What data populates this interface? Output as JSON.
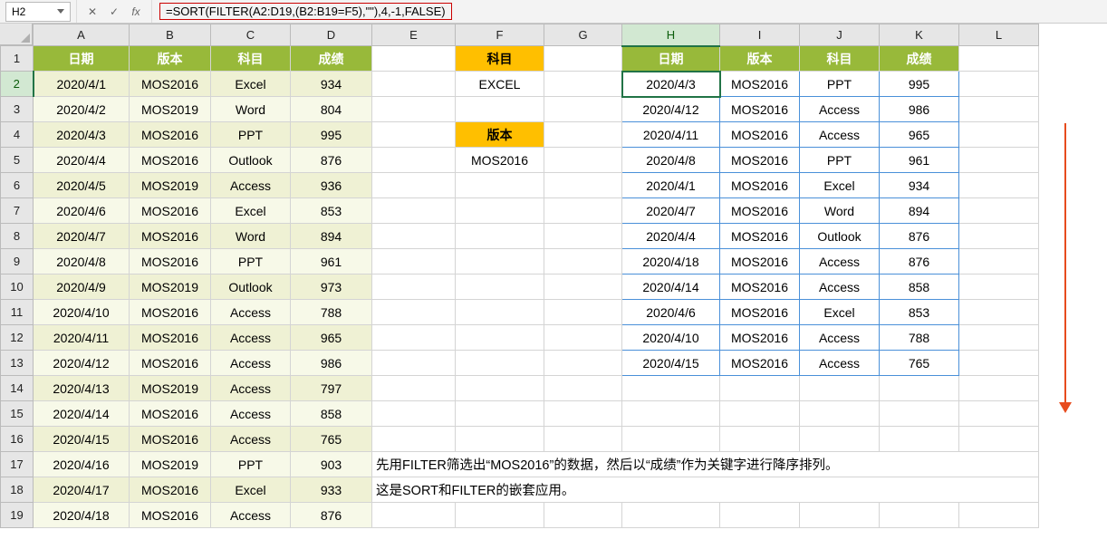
{
  "nameBox": "H2",
  "formula": "=SORT(FILTER(A2:D19,(B2:B19=F5),\"\"),4,-1,FALSE)",
  "fbIcons": {
    "cancel": "✕",
    "confirm": "✓",
    "fx": "fx"
  },
  "columns": [
    "A",
    "B",
    "C",
    "D",
    "E",
    "F",
    "G",
    "H",
    "I",
    "J",
    "K",
    "L"
  ],
  "leftHeader": [
    "日期",
    "版本",
    "科目",
    "成绩"
  ],
  "leftData": [
    [
      "2020/4/1",
      "MOS2016",
      "Excel",
      "934"
    ],
    [
      "2020/4/2",
      "MOS2019",
      "Word",
      "804"
    ],
    [
      "2020/4/3",
      "MOS2016",
      "PPT",
      "995"
    ],
    [
      "2020/4/4",
      "MOS2016",
      "Outlook",
      "876"
    ],
    [
      "2020/4/5",
      "MOS2019",
      "Access",
      "936"
    ],
    [
      "2020/4/6",
      "MOS2016",
      "Excel",
      "853"
    ],
    [
      "2020/4/7",
      "MOS2016",
      "Word",
      "894"
    ],
    [
      "2020/4/8",
      "MOS2016",
      "PPT",
      "961"
    ],
    [
      "2020/4/9",
      "MOS2019",
      "Outlook",
      "973"
    ],
    [
      "2020/4/10",
      "MOS2016",
      "Access",
      "788"
    ],
    [
      "2020/4/11",
      "MOS2016",
      "Access",
      "965"
    ],
    [
      "2020/4/12",
      "MOS2016",
      "Access",
      "986"
    ],
    [
      "2020/4/13",
      "MOS2019",
      "Access",
      "797"
    ],
    [
      "2020/4/14",
      "MOS2016",
      "Access",
      "858"
    ],
    [
      "2020/4/15",
      "MOS2016",
      "Access",
      "765"
    ],
    [
      "2020/4/16",
      "MOS2019",
      "PPT",
      "903"
    ],
    [
      "2020/4/17",
      "MOS2016",
      "Excel",
      "933"
    ],
    [
      "2020/4/18",
      "MOS2016",
      "Access",
      "876"
    ]
  ],
  "filterLabels": {
    "subject": "科目",
    "subjectVal": "EXCEL",
    "version": "版本",
    "versionVal": "MOS2016"
  },
  "rightHeader": [
    "日期",
    "版本",
    "科目",
    "成绩"
  ],
  "rightData": [
    [
      "2020/4/3",
      "MOS2016",
      "PPT",
      "995"
    ],
    [
      "2020/4/12",
      "MOS2016",
      "Access",
      "986"
    ],
    [
      "2020/4/11",
      "MOS2016",
      "Access",
      "965"
    ],
    [
      "2020/4/8",
      "MOS2016",
      "PPT",
      "961"
    ],
    [
      "2020/4/1",
      "MOS2016",
      "Excel",
      "934"
    ],
    [
      "2020/4/7",
      "MOS2016",
      "Word",
      "894"
    ],
    [
      "2020/4/4",
      "MOS2016",
      "Outlook",
      "876"
    ],
    [
      "2020/4/18",
      "MOS2016",
      "Access",
      "876"
    ],
    [
      "2020/4/14",
      "MOS2016",
      "Access",
      "858"
    ],
    [
      "2020/4/6",
      "MOS2016",
      "Excel",
      "853"
    ],
    [
      "2020/4/10",
      "MOS2016",
      "Access",
      "788"
    ],
    [
      "2020/4/15",
      "MOS2016",
      "Access",
      "765"
    ]
  ],
  "note1": "先用FILTER筛选出“MOS2016”的数据，然后以“成绩”作为关键字进行降序排列。",
  "note2": "这是SORT和FILTER的嵌套应用。"
}
